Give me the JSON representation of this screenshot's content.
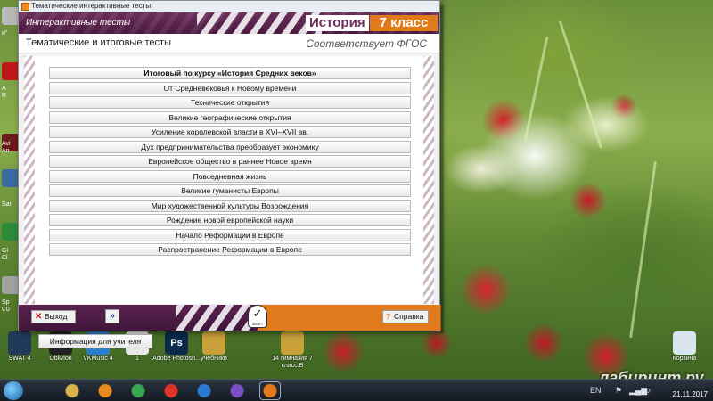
{
  "desktop": {
    "left_labels": [
      "и\"",
      "A",
      "R",
      "Avi",
      "An",
      "Sai",
      "Gi",
      "Cl",
      "Sp",
      "v.0"
    ],
    "icons": [
      {
        "label": "SWAT 4",
        "glyph": "",
        "color": "#203a5a",
        "icon": "swat-icon"
      },
      {
        "label": "Oblivion",
        "glyph": "",
        "color": "#222222",
        "icon": "oblivion-icon"
      },
      {
        "label": "VKMusic 4",
        "glyph": "♫",
        "color": "#2a7fd0",
        "icon": "vkmusic-icon"
      },
      {
        "label": "1",
        "glyph": "",
        "color": "#e8e8e8",
        "icon": "document-icon"
      },
      {
        "label": "Adobe Photosh...",
        "glyph": "Ps",
        "color": "#0b2a4a",
        "icon": "photoshop-icon"
      },
      {
        "label": "учебники",
        "glyph": "",
        "color": "#c9a13a",
        "icon": "folder-icon"
      },
      {
        "label": "14 гимназия 7 класс.В",
        "glyph": "",
        "color": "#c9a13a",
        "icon": "folder-icon"
      },
      {
        "label": "Корзина",
        "glyph": "",
        "color": "#d8e4ee",
        "icon": "recycle-bin-icon"
      }
    ],
    "watermark": "лабиринт.ру"
  },
  "taskbar": {
    "items": [
      {
        "icon": "explorer-icon",
        "color": "#d8b34a"
      },
      {
        "icon": "media-player-icon",
        "color": "#e88a1c"
      },
      {
        "icon": "chrome-icon",
        "color": "#3aa852"
      },
      {
        "icon": "alarm-icon",
        "color": "#e0332a"
      },
      {
        "icon": "globe-icon",
        "color": "#2a7ad0"
      },
      {
        "icon": "viber-icon",
        "color": "#7b4fc9"
      },
      {
        "icon": "tests-app-icon",
        "color": "#e07a1c"
      }
    ],
    "tray_lang": "EN",
    "clock_date": "21.11.2017"
  },
  "window": {
    "title": "Тематические интерактивные тесты",
    "header_tab": "Интерактивные тесты",
    "subject": "История",
    "grade": "7 класс",
    "section_title": "Тематические и итоговые тесты",
    "fgos": "Соответствует ФГОС",
    "tests": [
      "Итоговый по курсу «История Средних веков»",
      "От Средневековья к Новому времени",
      "Технические открытия",
      "Великие географические открытия",
      "Усиление королевской власти в XVI–XVII вв.",
      "Дух предпринимательства преобразует экономику",
      "Европейское общество в раннее Новое время",
      "Повседневная жизнь",
      "Великие гуманисты Европы",
      "Мир художественной культуры Возрождения",
      "Рождение новой европейской науки",
      "Начало Реформации в Европе",
      "Распространение Реформации в Европе"
    ],
    "teacher_button": "Информация для учителя",
    "exit_button": "Выход",
    "next_button": "»",
    "logo_caption": "ЗАЧЁТ",
    "help_button": "Справка"
  }
}
